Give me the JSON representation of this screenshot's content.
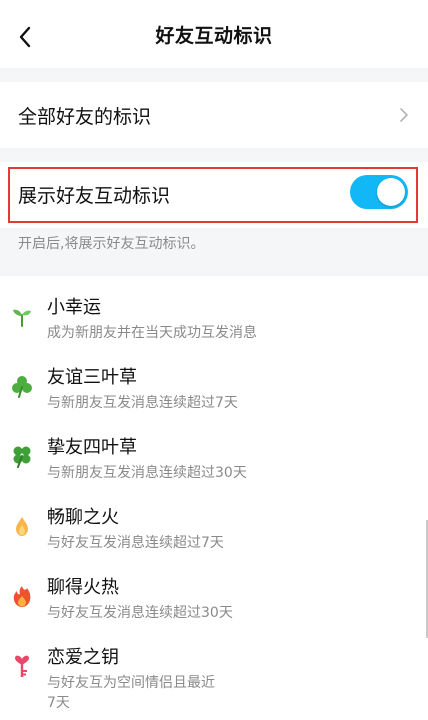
{
  "header": {
    "title": "好友互动标识"
  },
  "all_friends": {
    "label": "全部好友的标识"
  },
  "toggle": {
    "label": "展示好友互动标识",
    "on": true,
    "note": "开启后,将展示好友互动标识。"
  },
  "badges": [
    {
      "icon": "sprout-icon",
      "name": "小幸运",
      "desc": "成为新朋友并在当天成功互发消息"
    },
    {
      "icon": "three-leaf-clover-icon",
      "name": "友谊三叶草",
      "desc": "与新朋友互发消息连续超过7天"
    },
    {
      "icon": "four-leaf-clover-icon",
      "name": "挚友四叶草",
      "desc": "与新朋友互发消息连续超过30天"
    },
    {
      "icon": "small-flame-icon",
      "name": "畅聊之火",
      "desc": "与好友互发消息连续超过7天"
    },
    {
      "icon": "big-flame-icon",
      "name": "聊得火热",
      "desc": "与好友互发消息连续超过30天"
    },
    {
      "icon": "love-key-icon",
      "name": "恋爱之钥",
      "desc": "与好友互为空间情侣且最近",
      "desc_line2": "7天"
    }
  ],
  "colors": {
    "accent": "#12b7f5",
    "highlight": "#e53935",
    "section_bg": "#f5f6f8"
  }
}
